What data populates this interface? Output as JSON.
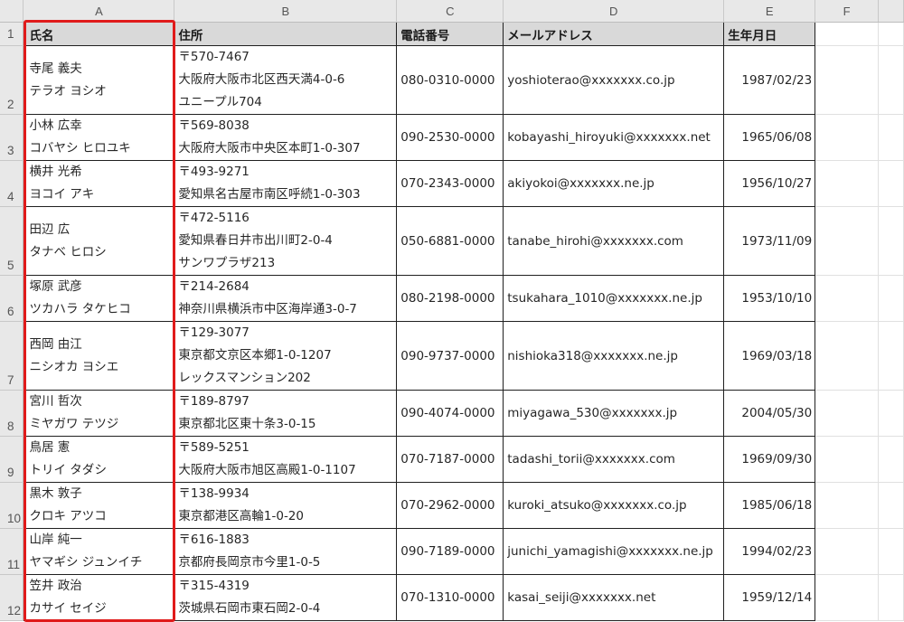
{
  "columns": [
    "A",
    "B",
    "C",
    "D",
    "E",
    "F"
  ],
  "colors": {
    "selection": "#e01b1b",
    "header_fill": "#d9d9d9"
  },
  "header": {
    "row_number": "1",
    "name": "氏名",
    "address": "住所",
    "phone": "電話番号",
    "email": "メールアドレス",
    "birthdate": "生年月日"
  },
  "rows": [
    {
      "row_number": "2",
      "name": [
        "寺尾 義夫",
        "テラオ ヨシオ"
      ],
      "address": [
        "〒570-7467",
        "大阪府大阪市北区西天満4-0-6",
        "ユニープル704"
      ],
      "phone": "080-0310-0000",
      "email": "yoshioterao@xxxxxxx.co.jp",
      "birthdate": "1987/02/23"
    },
    {
      "row_number": "3",
      "name": [
        "小林 広幸",
        "コバヤシ ヒロユキ"
      ],
      "address": [
        "〒569-8038",
        "大阪府大阪市中央区本町1-0-307"
      ],
      "phone": "090-2530-0000",
      "email": "kobayashi_hiroyuki@xxxxxxx.net",
      "birthdate": "1965/06/08"
    },
    {
      "row_number": "4",
      "name": [
        "横井 光希",
        "ヨコイ アキ"
      ],
      "address": [
        "〒493-9271",
        "愛知県名古屋市南区呼続1-0-303"
      ],
      "phone": "070-2343-0000",
      "email": "akiyokoi@xxxxxxx.ne.jp",
      "birthdate": "1956/10/27"
    },
    {
      "row_number": "5",
      "name": [
        "田辺 広",
        "タナベ ヒロシ"
      ],
      "address": [
        "〒472-5116",
        "愛知県春日井市出川町2-0-4",
        "サンワプラザ213"
      ],
      "phone": "050-6881-0000",
      "email": "tanabe_hirohi@xxxxxxx.com",
      "birthdate": "1973/11/09"
    },
    {
      "row_number": "6",
      "name": [
        "塚原 武彦",
        "ツカハラ タケヒコ"
      ],
      "address": [
        "〒214-2684",
        "神奈川県横浜市中区海岸通3-0-7"
      ],
      "phone": "080-2198-0000",
      "email": "tsukahara_1010@xxxxxxx.ne.jp",
      "birthdate": "1953/10/10"
    },
    {
      "row_number": "7",
      "name": [
        "西岡 由江",
        "ニシオカ ヨシエ"
      ],
      "address": [
        "〒129-3077",
        "東京都文京区本郷1-0-1207",
        "レックスマンション202"
      ],
      "phone": "090-9737-0000",
      "email": "nishioka318@xxxxxxx.ne.jp",
      "birthdate": "1969/03/18"
    },
    {
      "row_number": "8",
      "name": [
        "宮川 哲次",
        "ミヤガワ テツジ"
      ],
      "address": [
        "〒189-8797",
        "東京都北区東十条3-0-15"
      ],
      "phone": "090-4074-0000",
      "email": "miyagawa_530@xxxxxxx.jp",
      "birthdate": "2004/05/30"
    },
    {
      "row_number": "9",
      "name": [
        "鳥居 憲",
        "トリイ タダシ"
      ],
      "address": [
        "〒589-5251",
        "大阪府大阪市旭区高殿1-0-1107"
      ],
      "phone": "070-7187-0000",
      "email": "tadashi_torii@xxxxxxx.com",
      "birthdate": "1969/09/30"
    },
    {
      "row_number": "10",
      "name": [
        "黒木 敦子",
        "クロキ アツコ"
      ],
      "address": [
        "〒138-9934",
        "東京都港区高輪1-0-20"
      ],
      "phone": "070-2962-0000",
      "email": "kuroki_atsuko@xxxxxxx.co.jp",
      "birthdate": "1985/06/18"
    },
    {
      "row_number": "11",
      "name": [
        "山岸 純一",
        "ヤマギシ ジュンイチ"
      ],
      "address": [
        "〒616-1883",
        "京都府長岡京市今里1-0-5"
      ],
      "phone": "090-7189-0000",
      "email": "junichi_yamagishi@xxxxxxx.ne.jp",
      "birthdate": "1994/02/23"
    },
    {
      "row_number": "12",
      "name": [
        "笠井 政治",
        "カサイ セイジ"
      ],
      "address": [
        "〒315-4319",
        "茨城県石岡市東石岡2-0-4"
      ],
      "phone": "070-1310-0000",
      "email": "kasai_seiji@xxxxxxx.net",
      "birthdate": "1959/12/14"
    }
  ]
}
